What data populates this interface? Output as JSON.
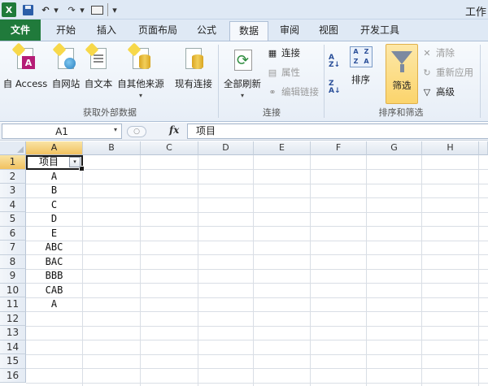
{
  "title": "工作",
  "qat": {
    "logo": "X",
    "undo": "↶",
    "redo": "↷",
    "dropdown": "▾",
    "more": "▾"
  },
  "tabs": [
    "文件",
    "开始",
    "插入",
    "页面布局",
    "公式",
    "数据",
    "审阅",
    "视图",
    "开发工具"
  ],
  "active_tab": "数据",
  "ribbon": {
    "get_external": {
      "label": "获取外部数据",
      "buttons": [
        "自 Access",
        "自网站",
        "自文本",
        "自其他来源",
        "现有连接"
      ],
      "access_badge": "A"
    },
    "connections": {
      "label": "连接",
      "refresh_all": "全部刷新",
      "connections": "连接",
      "properties": "属性",
      "edit_links": "编辑链接"
    },
    "sort_filter": {
      "label": "排序和筛选",
      "sort": "排序",
      "filter": "筛选",
      "clear": "清除",
      "reapply": "重新应用",
      "advanced": "高级",
      "sort_grid": [
        "A",
        "Z",
        "Z",
        "A"
      ]
    }
  },
  "formula_bar": {
    "name_box": "A1",
    "fx": "fx",
    "content": "项目",
    "collapse": "○"
  },
  "columns": [
    "A",
    "B",
    "C",
    "D",
    "E",
    "F",
    "G",
    "H"
  ],
  "rows": [
    "1",
    "2",
    "3",
    "4",
    "5",
    "6",
    "7",
    "8",
    "9",
    "10",
    "11",
    "12",
    "13",
    "14",
    "15",
    "16"
  ],
  "column_a": [
    "项目",
    "A",
    "B",
    "C",
    "D",
    "E",
    "ABC",
    "BAC",
    "BBB",
    "CAB",
    "A"
  ],
  "filter_arrow": "▾",
  "colors": {
    "file_tab": "#207a3b",
    "selected_header": "#f1c15f",
    "filter_button": "#fbd46c"
  }
}
